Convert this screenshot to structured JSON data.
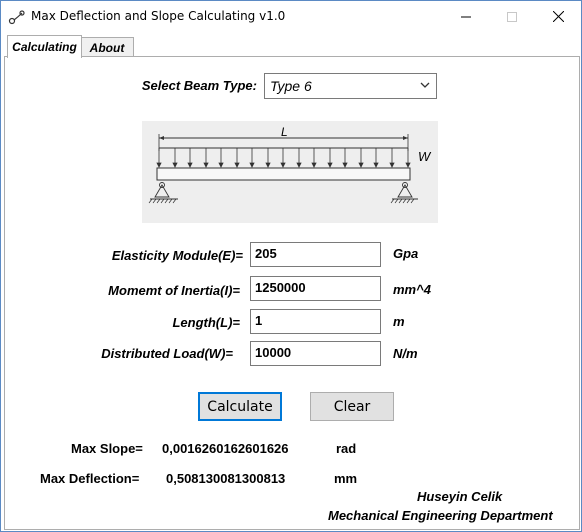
{
  "window": {
    "title": "Max Deflection and Slope Calculating v1.0",
    "minimize_icon": "minimize-icon",
    "maximize_icon": "maximize-icon",
    "close_icon": "close-icon"
  },
  "tabs": [
    {
      "label": "Calculating",
      "active": true
    },
    {
      "label": "About",
      "active": false
    }
  ],
  "beam_type": {
    "label": "Select Beam Type:",
    "selected": "Type 6"
  },
  "diagram": {
    "length_label": "L",
    "load_label": "W"
  },
  "inputs": {
    "elasticity": {
      "label": "Elasticity Module(E)=",
      "value": "205",
      "unit": "Gpa"
    },
    "inertia": {
      "label": "Momemt of Inertia(I)=",
      "value": "1250000",
      "unit": "mm^4"
    },
    "length": {
      "label": "Length(L)=",
      "value": "1",
      "unit": "m"
    },
    "load": {
      "label": "Distributed Load(W)=",
      "value": "10000",
      "unit": "N/m"
    }
  },
  "buttons": {
    "calculate": "Calculate",
    "clear": "Clear"
  },
  "results": {
    "slope": {
      "label": "Max Slope=",
      "value": "0,0016260162601626",
      "unit": "rad"
    },
    "deflection": {
      "label": "Max Deflection=",
      "value": "0,508130081300813",
      "unit": "mm"
    }
  },
  "author": {
    "name": "Huseyin Celik",
    "department": "Mechanical Engineering Department"
  },
  "colors": {
    "focus_border": "#0078d7",
    "button_bg": "#e1e1e1",
    "diagram_bg": "#eeeeee"
  }
}
